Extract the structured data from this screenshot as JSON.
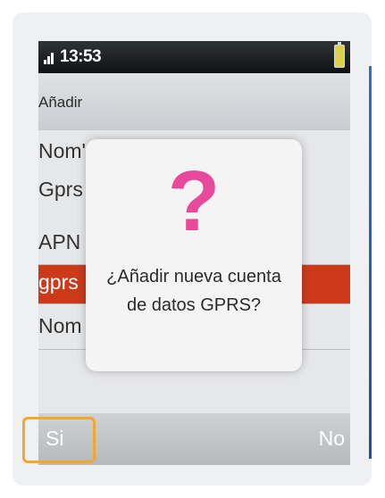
{
  "status_bar": {
    "time": "13:53",
    "signal_icon": "signal-bars-icon",
    "battery_icon": "battery-icon",
    "battery_color": "#d9d24a"
  },
  "header": {
    "title": "Añadir"
  },
  "list": {
    "rows": [
      {
        "label": "Nom'"
      },
      {
        "label": "Gprs"
      },
      {
        "label": "APN"
      },
      {
        "label": "gprs"
      },
      {
        "label": "Nom"
      }
    ],
    "selected_color": "#cc3a1a"
  },
  "dialog": {
    "icon": "question-mark-icon",
    "icon_symbol": "?",
    "icon_color": "#e84a9b",
    "message_line1": "¿Añadir nueva cuenta",
    "message_line2": "de datos GPRS?"
  },
  "softkeys": {
    "left": "Si",
    "right": "No"
  },
  "highlight_color": "#f0a830"
}
